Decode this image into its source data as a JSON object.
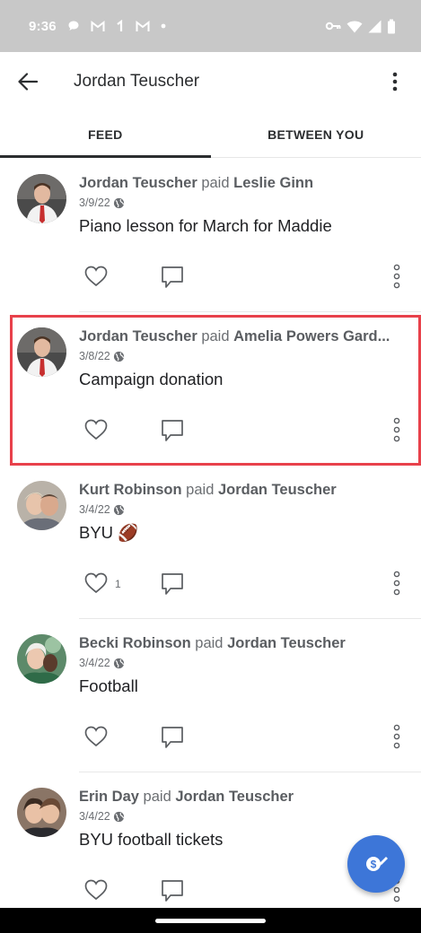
{
  "status_bar": {
    "time": "9:36",
    "left_icons": [
      "chat-bubble-icon",
      "gmail-icon",
      "signal-one-icon",
      "gmail-icon",
      "dot-icon"
    ],
    "right_icons": [
      "key-icon",
      "wifi-icon",
      "cell-signal-icon",
      "battery-icon"
    ]
  },
  "app_bar": {
    "title": "Jordan Teuscher",
    "back_icon": "arrow-left-icon",
    "more_icon": "more-vertical-icon"
  },
  "tabs": [
    {
      "label": "FEED",
      "active": true
    },
    {
      "label": "BETWEEN YOU",
      "active": false
    }
  ],
  "feed": [
    {
      "actor": "Jordan Teuscher",
      "verb": "paid",
      "target": "Leslie Ginn",
      "date": "3/9/22",
      "note": "Piano lesson for March for Maddie",
      "likes": ""
    },
    {
      "actor": "Jordan Teuscher",
      "verb": "paid",
      "target": "Amelia Powers Gard...",
      "date": "3/8/22",
      "note": "Campaign donation",
      "likes": "",
      "highlighted": true
    },
    {
      "actor": "Kurt Robinson",
      "verb": "paid",
      "target": "Jordan Teuscher",
      "date": "3/4/22",
      "note": "BYU 🏈",
      "likes": "1"
    },
    {
      "actor": "Becki Robinson",
      "verb": "paid",
      "target": "Jordan Teuscher",
      "date": "3/4/22",
      "note": "Football",
      "likes": ""
    },
    {
      "actor": "Erin Day",
      "verb": "paid",
      "target": "Jordan Teuscher",
      "date": "3/4/22",
      "note": "BYU football tickets",
      "likes": ""
    }
  ],
  "colors": {
    "highlight": "#e8414b",
    "fab": "#3d76d8",
    "status_bar": "#c8c8c8"
  },
  "fab": {
    "icon": "pay-request-icon"
  }
}
